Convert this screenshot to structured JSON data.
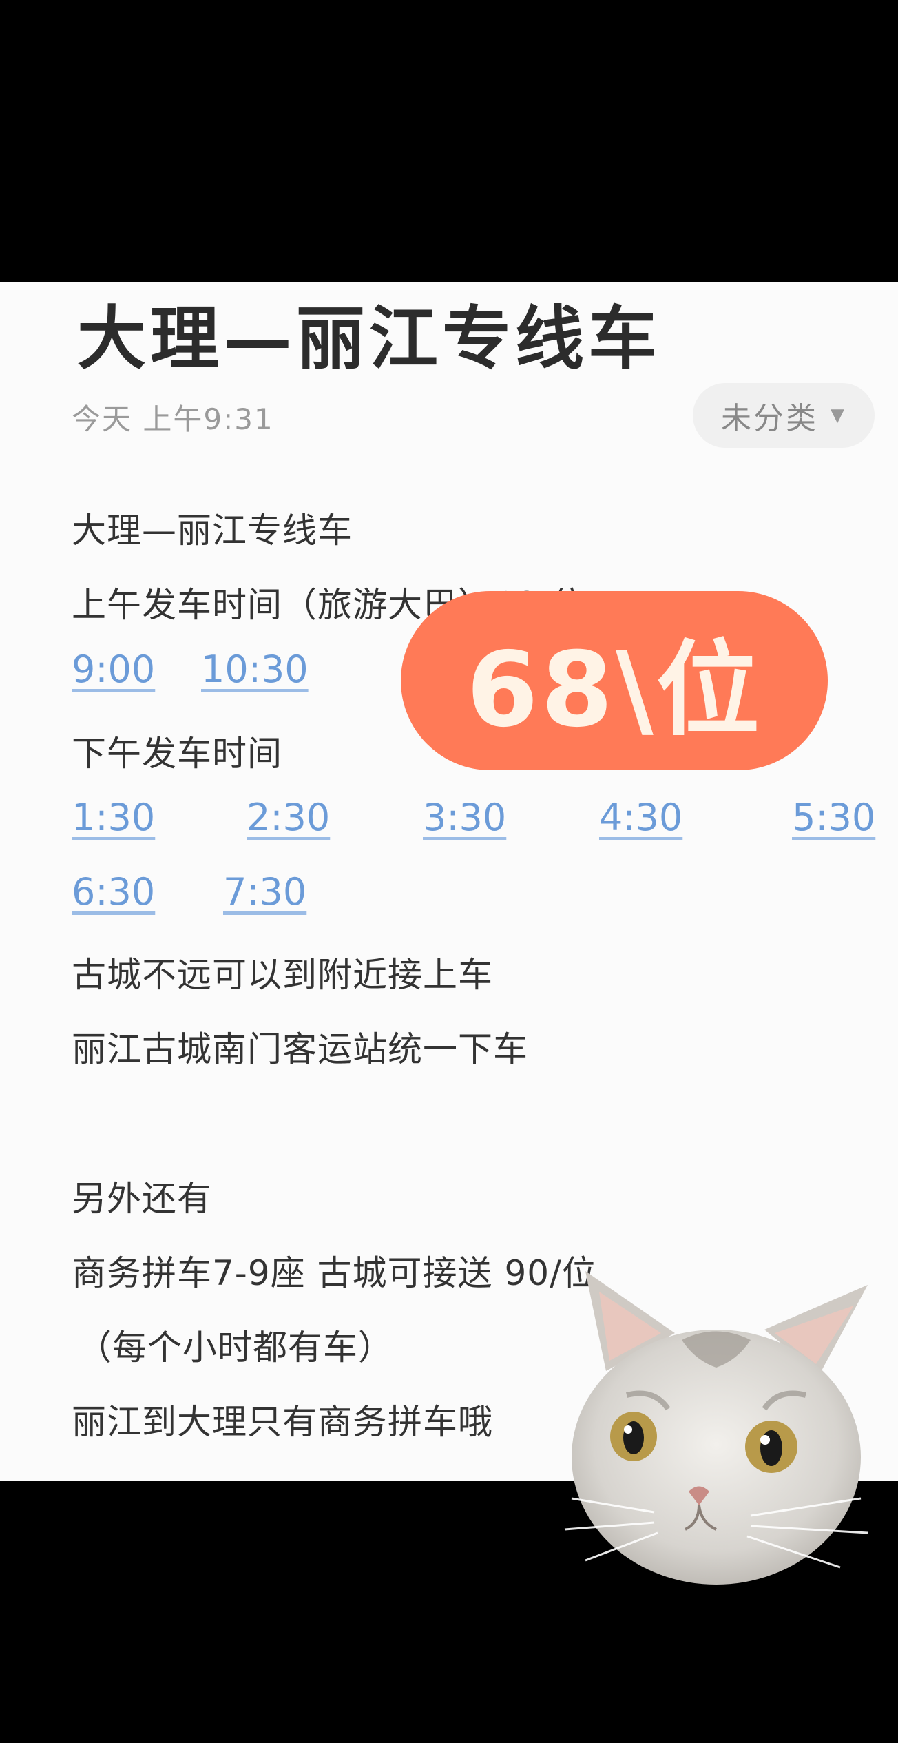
{
  "note": {
    "title": "大理—丽江专线车",
    "date": "今天 上午9:31",
    "category": "未分类",
    "lines": {
      "route": "大理—丽江专线车",
      "morning": "上午发车时间（旅游大巴）68/位",
      "afternoon": "下午发车时间",
      "pickup": "古城不远可以到附近接上车",
      "dropoff": "丽江古城南门客运站统一下车",
      "also": "另外还有",
      "business": "商务拼车7-9座   古城可接送  90/位",
      "hourly": "（每个小时都有车）",
      "return": "丽江到大理只有商务拼车哦"
    },
    "morning_times": [
      "9:00",
      "10:30"
    ],
    "afternoon_times": [
      "1:30",
      "2:30",
      "3:30",
      "4:30",
      "5:30",
      "6:30",
      "7:30"
    ]
  },
  "overlay": {
    "badge": "68\\位",
    "badge_color": "#ff7a57"
  },
  "colors": {
    "link": "#6b9bd8",
    "text": "#333333"
  }
}
